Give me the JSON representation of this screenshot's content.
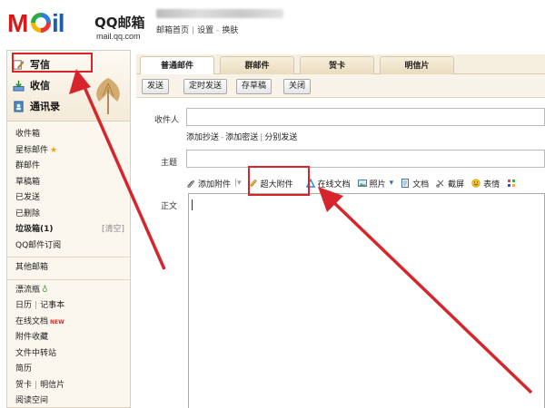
{
  "header": {
    "logo_letters": [
      "M",
      "il"
    ],
    "logo_cn": "QQ邮箱",
    "logo_url": "mail.qq.com",
    "top_links": [
      "邮箱首页",
      "设置",
      "换肤"
    ]
  },
  "sidebar": {
    "compose": "写信",
    "inbox": "收信",
    "contacts": "通讯录",
    "folders": [
      "收件箱",
      "星标邮件",
      "群邮件",
      "草稿箱",
      "已发送",
      "已删除",
      "垃圾箱(1)",
      "QQ邮件订阅"
    ],
    "clear_label": "[清空]",
    "other_folders": "其他邮箱",
    "apps": [
      "漂流瓶",
      "日历",
      "记事本",
      "在线文档",
      "附件收藏",
      "文件中转站",
      "简历",
      "贺卡",
      "明信片",
      "阅读空间"
    ],
    "new_tag": "NEW"
  },
  "tabs": [
    "普通邮件",
    "群邮件",
    "贺卡",
    "明信片"
  ],
  "toolbar": [
    "发送",
    "定时发送",
    "存草稿",
    "关闭"
  ],
  "form": {
    "to_label": "收件人",
    "cc_links": [
      "添加抄送",
      "添加密送",
      "分别发送"
    ],
    "subject_label": "主题",
    "body_label": "正文",
    "attach_items": [
      "添加附件",
      "超大附件",
      "在线文档",
      "照片",
      "文档",
      "截屏",
      "表情"
    ]
  }
}
